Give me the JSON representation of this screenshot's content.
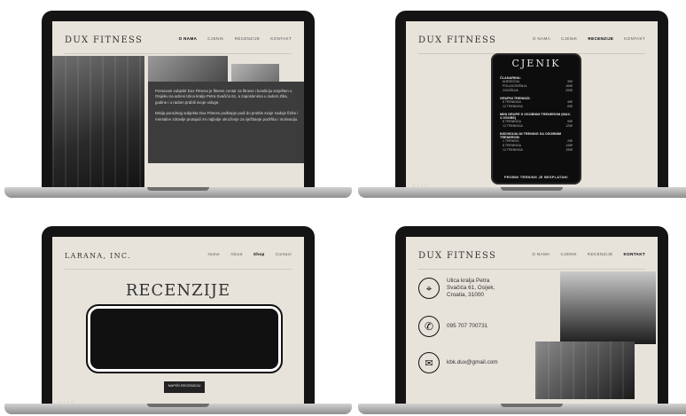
{
  "screen1": {
    "logo": "DUX FITNESS",
    "nav": [
      "O NAMA",
      "CJENIK",
      "RECENZIJE",
      "KONTAKT"
    ],
    "about_p1": "Postovani subjekti Dux Fitness je fitness centar za fitness i kondiciju smješten u Osijeku na adresi Ulica kralja Petra Svačića 61, a zaposlenima u radom Zika, godine i u radom prabili svoje usluge.",
    "about_p2": "Misija porodnog subjekta Dux Fitness podkepje podi do prutitie svoje nadoje fizike i mentalne zdravlje prutajući im najbolje okruženje za vježbanje podršku i motivaciju."
  },
  "screen2": {
    "logo": "DUX FITNESS",
    "nav": [
      "O NAMA",
      "CJENIK",
      "RECENZIJE",
      "KONTAKT"
    ],
    "phone_title": "CJENIK",
    "categories": [
      {
        "name": "ČLANARINA:",
        "rows": [
          [
            "MJESEČNA",
            "30€"
          ],
          [
            "POLUGODIŠNJA",
            "160€"
          ],
          [
            "GODIŠNJA",
            "290€"
          ]
        ]
      },
      {
        "name": "GRUPNI TRENINZI:",
        "rows": [
          [
            "8 TRENINGA",
            "45€"
          ],
          [
            "12 TRENINGA",
            "60€"
          ]
        ]
      },
      {
        "name": "MINI GRUPE S OSOBNIM TRENEROM (MAX. 4 OSOBE)",
        "rows": [
          [
            "8 TRENINGA",
            "90€"
          ],
          [
            "12 TRENINGA",
            "120€"
          ]
        ]
      },
      {
        "name": "INDIVIDUALNI TRENING SA OSOBNIM TRENEROM",
        "rows": [
          [
            "1 TRENING",
            "20€"
          ],
          [
            "8 TRENINGA",
            "140€"
          ],
          [
            "12 TRENINGA",
            "190€"
          ]
        ]
      }
    ],
    "footer": "PROBNI TRENING JE BESPLATAN!"
  },
  "screen3": {
    "logo": "LARANA, INC.",
    "nav": [
      "Home",
      "About",
      "Shop",
      "Contact"
    ],
    "title": "RECENZIJE",
    "button": "NAPIŠI RECENZIJU"
  },
  "screen4": {
    "logo": "DUX FITNESS",
    "nav": [
      "O NAMA",
      "CJENIK",
      "RECENZIJE",
      "KONTAKT"
    ],
    "address": "Ulica kralja Petra\nSvačića 61, Osijek,\nCroatia, 31000",
    "phone": "095 707 700731",
    "email": "kbk.dux@gmail.com"
  },
  "icons": {
    "location": "location-pin-icon",
    "phone": "phone-icon",
    "email": "envelope-icon"
  }
}
